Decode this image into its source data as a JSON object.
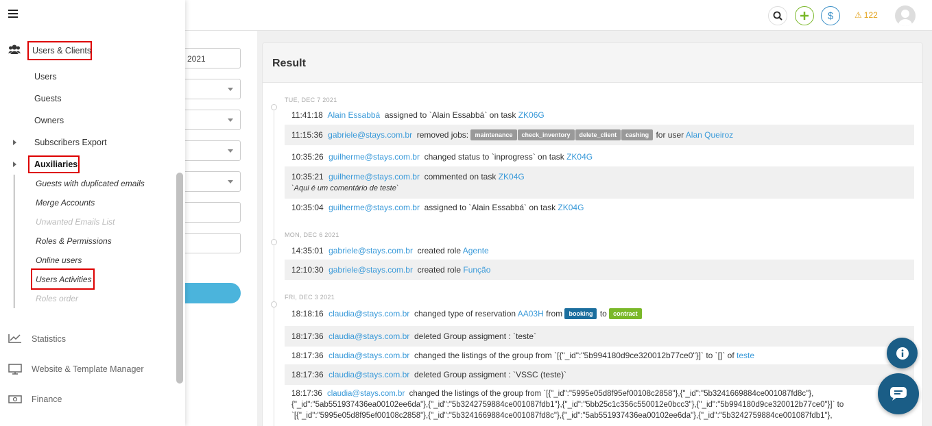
{
  "topbar": {
    "warning_count": "122",
    "icons": [
      "search-icon",
      "plus-icon",
      "dollar-icon",
      "warning-icon",
      "avatar"
    ]
  },
  "form": {
    "date_value": "2021"
  },
  "result": {
    "title": "Result",
    "groups": [
      {
        "date": "TUE, DEC 7 2021",
        "rows": [
          {
            "time": "11:41:18",
            "user": "Alain Essabbá",
            "text": "assigned to `Alain Essabbá` on task",
            "link": "ZK06G"
          },
          {
            "time": "11:15:36",
            "user": "gabriele@stays.com.br",
            "text": "removed jobs:",
            "tags": [
              "maintenance",
              "check_inventory",
              "delete_client",
              "cashing"
            ],
            "suffix": "for user",
            "link": "Alan Queiroz"
          },
          {
            "time": "10:35:26",
            "user": "guilherme@stays.com.br",
            "text": "changed status to `inprogress` on task",
            "link": "ZK04G"
          },
          {
            "time": "10:35:21",
            "user": "guilherme@stays.com.br",
            "text": "commented on task",
            "link": "ZK04G",
            "comment": "`Aqui é um comentário de teste`"
          },
          {
            "time": "10:35:04",
            "user": "guilherme@stays.com.br",
            "text": "assigned to `Alain Essabbá` on task",
            "link": "ZK04G"
          }
        ]
      },
      {
        "date": "MON, DEC 6 2021",
        "rows": [
          {
            "time": "14:35:01",
            "user": "gabriele@stays.com.br",
            "text": "created role",
            "link": "Agente"
          },
          {
            "time": "12:10:30",
            "user": "gabriele@stays.com.br",
            "text": "created role",
            "link": "Função"
          }
        ]
      },
      {
        "date": "FRI, DEC 3 2021",
        "rows": [
          {
            "time": "18:18:16",
            "user": "claudia@stays.com.br",
            "text": "changed type of reservation",
            "link": "AA03H",
            "from_word": "from",
            "from_tag": "booking",
            "to_word": "to",
            "to_tag": "contract"
          },
          {
            "time": "18:17:36",
            "user": "claudia@stays.com.br",
            "text": "deleted Group assigment : `teste`"
          },
          {
            "time": "18:17:36",
            "user": "claudia@stays.com.br",
            "text": "changed the listings of the group from `[{\"_id\":\"5b994180d9ce320012b77ce0\"}]` to `[]` of",
            "link": "teste"
          },
          {
            "time": "18:17:36",
            "user": "claudia@stays.com.br",
            "text": "deleted Group assigment : `VSSC (teste)`"
          },
          {
            "time": "18:17:36",
            "user": "claudia@stays.com.br",
            "text": "changed the listings of the group from `[{\"_id\":\"5995e05d8f95ef00108c2858\"},{\"_id\":\"5b3241669884ce001087fd8c\"},",
            "line2": "{\"_id\":\"5ab551937436ea00102ee6da\"},{\"_id\":\"5b3242759884ce001087fdb1\"},{\"_id\":\"5bb25c1c356c550012e0bcc3\"},{\"_id\":\"5b994180d9ce320012b77ce0\"}]` to",
            "line3": "`[{\"_id\":\"5995e05d8f95ef00108c2858\"},{\"_id\":\"5b3241669884ce001087fd8c\"},{\"_id\":\"5ab551937436ea00102ee6da\"},{\"_id\":\"5b3242759884ce001087fdb1\"},"
          }
        ]
      }
    ]
  },
  "sidebar": {
    "section": "Users & Clients",
    "items": [
      "Users",
      "Guests",
      "Owners",
      "Subscribers Export",
      "Auxiliaries"
    ],
    "aux_items": [
      "Guests with duplicated emails",
      "Merge Accounts",
      "Unwanted Emails List",
      "Roles & Permissions",
      "Online users",
      "Users Activities",
      "Roles order"
    ],
    "main": [
      "Statistics",
      "Website & Template Manager",
      "Finance"
    ]
  }
}
